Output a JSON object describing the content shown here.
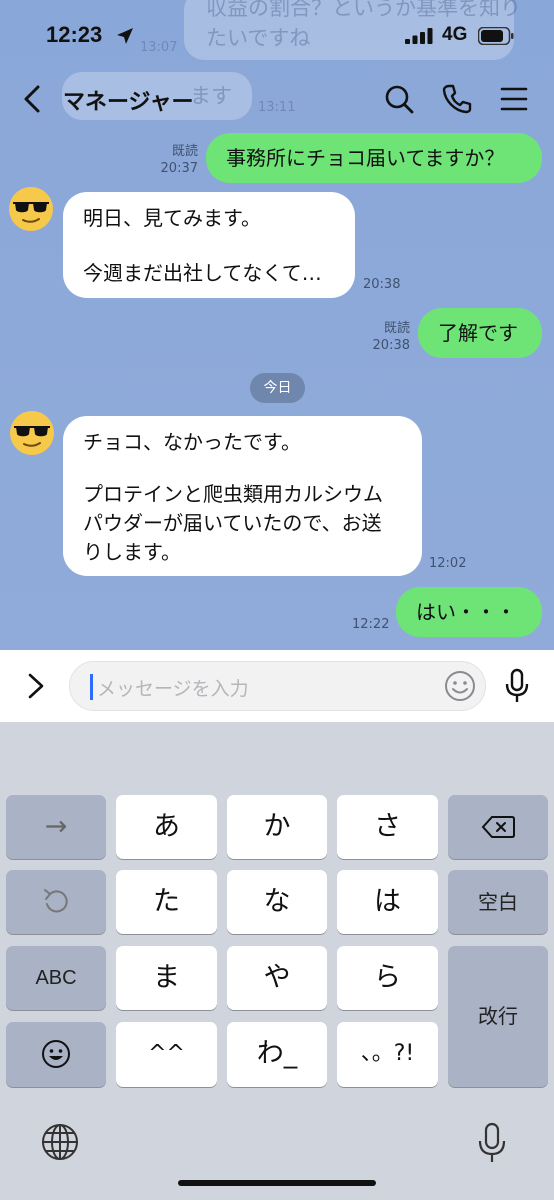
{
  "status_bar": {
    "time": "12:23",
    "network": "4G"
  },
  "background_ghost": {
    "line1": "収益の割合？というか基準を知り",
    "line2": "たいですね",
    "time_a": "13:07",
    "text_b": "ます",
    "time_b": "13:11"
  },
  "header": {
    "title": "マネージャー"
  },
  "messages": [
    {
      "side": "me",
      "text": "事務所にチョコ届いてますか？",
      "read": "既読",
      "time": "20:37"
    },
    {
      "side": "them",
      "line1": "明日、見てみます。",
      "line2": "今週まだ出社してなくて…",
      "time": "20:38"
    },
    {
      "side": "me",
      "text": "了解です",
      "read": "既読",
      "time": "20:38"
    },
    {
      "side": "them",
      "line1": "チョコ、なかったです。",
      "line2": "プロテインと爬虫類用カルシウム",
      "line3": "パウダーが届いていたので、お送",
      "line4": "りします。",
      "time": "12:02"
    },
    {
      "side": "me",
      "text": "はい・・・",
      "time": "12:22"
    }
  ],
  "date_divider": "今日",
  "input": {
    "placeholder": "メッセージを入力"
  },
  "keyboard": {
    "row1": [
      "あ",
      "か",
      "さ"
    ],
    "row2": [
      "た",
      "な",
      "は"
    ],
    "row3": [
      "ま",
      "や",
      "ら"
    ],
    "row4": [
      "^^",
      "わ_",
      "、。?!"
    ],
    "space": "空白",
    "return": "改行",
    "abc": "ABC",
    "arrow": "→"
  },
  "colors": {
    "chat_bg": "#8ea9d8",
    "my_bubble": "#6ee477",
    "their_bubble": "#ffffff",
    "keyboard_bg": "#d0d4dc"
  },
  "icons": [
    "location-arrow-icon",
    "signal-icon",
    "battery-icon",
    "back-icon",
    "search-icon",
    "phone-icon",
    "menu-icon",
    "sunglasses-emoji-icon",
    "expand-icon",
    "emoji-icon",
    "mic-icon",
    "backspace-icon",
    "undo-icon",
    "emoji-key-icon",
    "globe-icon",
    "dictation-mic-icon"
  ]
}
